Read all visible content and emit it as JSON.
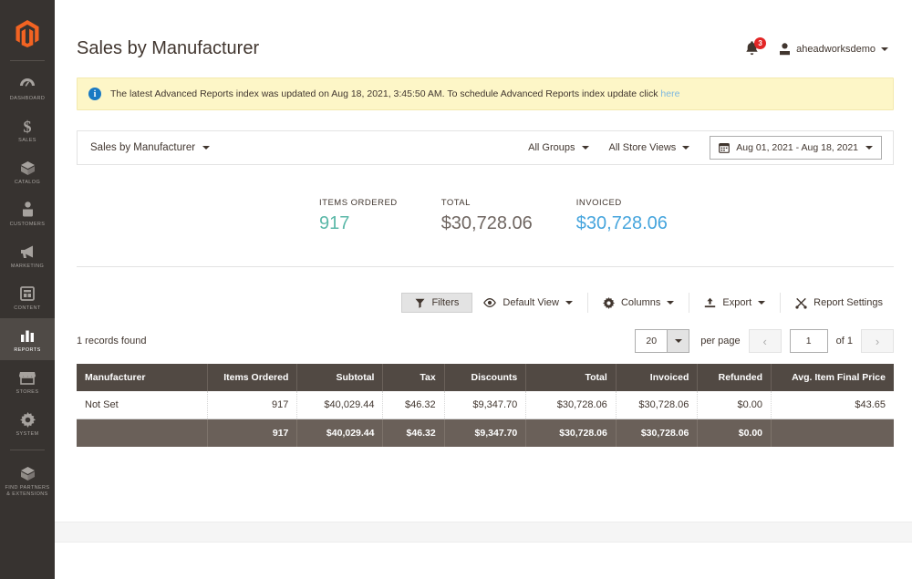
{
  "sidebar": {
    "logo_name": "magento-logo-icon",
    "items": [
      {
        "label": "DASHBOARD",
        "icon": "dashboard-icon",
        "active": false
      },
      {
        "label": "SALES",
        "icon": "dollar-icon",
        "active": false
      },
      {
        "label": "CATALOG",
        "icon": "catalog-box-icon",
        "active": false
      },
      {
        "label": "CUSTOMERS",
        "icon": "customers-person-icon",
        "active": false
      },
      {
        "label": "MARKETING",
        "icon": "megaphone-icon",
        "active": false
      },
      {
        "label": "CONTENT",
        "icon": "content-page-icon",
        "active": false
      },
      {
        "label": "REPORTS",
        "icon": "bar-chart-icon",
        "active": true
      },
      {
        "label": "STORES",
        "icon": "storefront-icon",
        "active": false
      },
      {
        "label": "SYSTEM",
        "icon": "gear-icon",
        "active": false
      },
      {
        "label": "FIND PARTNERS\n& EXTENSIONS",
        "icon": "partners-box-icon",
        "active": false
      }
    ]
  },
  "header": {
    "title": "Sales by Manufacturer",
    "notification_count": "3",
    "user_name": "aheadworksdemo"
  },
  "notice": {
    "text": "The latest Advanced Reports index was updated on Aug 18, 2021, 3:45:50 AM. To schedule Advanced Reports index update click ",
    "link_text": "here"
  },
  "filter_bar": {
    "report_select": "Sales by Manufacturer",
    "groups": "All Groups",
    "store_views": "All Store Views",
    "date_range": "Aug 01, 2021 - Aug 18, 2021"
  },
  "kpis": [
    {
      "label": "ITEMS ORDERED",
      "value": "917",
      "color_class": "teal",
      "color": "#5bb8a8"
    },
    {
      "label": "TOTAL",
      "value": "$30,728.06",
      "color_class": "gray",
      "color": "#6f6661"
    },
    {
      "label": "INVOICED",
      "value": "$30,728.06",
      "color_class": "blue",
      "color": "#46a5dd"
    }
  ],
  "toolbar": {
    "filters": "Filters",
    "default_view": "Default View",
    "columns": "Columns",
    "export": "Export",
    "report_settings": "Report Settings"
  },
  "grid_top": {
    "records_found": "1 records found",
    "per_page_value": "20",
    "per_page_label": "per page",
    "current_page": "1",
    "of_pages": "of 1"
  },
  "table": {
    "columns": [
      "Manufacturer",
      "Items Ordered",
      "Subtotal",
      "Tax",
      "Discounts",
      "Total",
      "Invoiced",
      "Refunded",
      "Avg. Item Final Price"
    ],
    "rows": [
      [
        "Not Set",
        "917",
        "$40,029.44",
        "$46.32",
        "$9,347.70",
        "$30,728.06",
        "$30,728.06",
        "$0.00",
        "$43.65"
      ]
    ],
    "totals": [
      "",
      "917",
      "$40,029.44",
      "$46.32",
      "$9,347.70",
      "$30,728.06",
      "$30,728.06",
      "$0.00",
      ""
    ]
  }
}
